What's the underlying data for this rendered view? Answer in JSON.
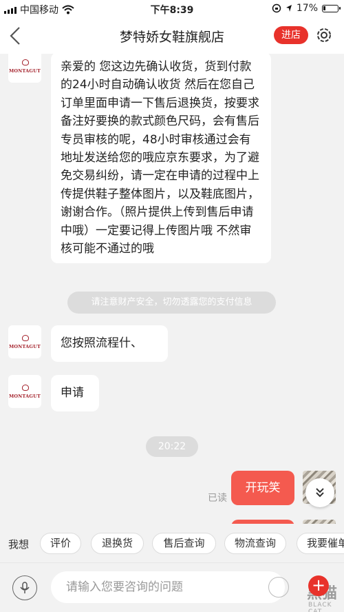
{
  "status_bar": {
    "carrier": "中国移动",
    "time": "下午8:39",
    "battery": "17%",
    "battery_level": 0.17
  },
  "header": {
    "title": "梦特娇女鞋旗舰店",
    "enter_shop_label": "进店"
  },
  "shop": {
    "logo_text": "MONTAGUT"
  },
  "chat": {
    "messages": [
      {
        "from": "shop",
        "text": "亲爱的 您这边先确认收货，货到付款的24小时自动确认收货 然后在您自己订单里面申请一下售后退换货，按要求备注好要换的款式颜色尺码，会有售后专员审核的呢，48小时审核通过会有地址发送给您的哦应京东要求，为了避免交易纠纷，请一定在申请的过程中上传提供鞋子整体图片，以及鞋底图片，谢谢合作。（照片提供上传到售后申请中哦）一定要记得上传图片哦 不然审核可能不通过的哦"
      },
      {
        "from": "shop",
        "text": "您按照流程什、"
      },
      {
        "from": "shop",
        "text": "申请"
      },
      {
        "from": "user",
        "text": "开玩笑"
      }
    ],
    "notice": "请注意财产安全，切勿透露您的支付信息",
    "timestamp": "20:22",
    "read_status": "已读"
  },
  "quick_replies": {
    "label": "我想",
    "items": [
      "评价",
      "退换货",
      "售后查询",
      "物流查询",
      "我要催单"
    ]
  },
  "input": {
    "placeholder": "请输入您要咨询的问题"
  },
  "watermark": {
    "text": "黑猫",
    "subtext": "BLACK CAT"
  }
}
